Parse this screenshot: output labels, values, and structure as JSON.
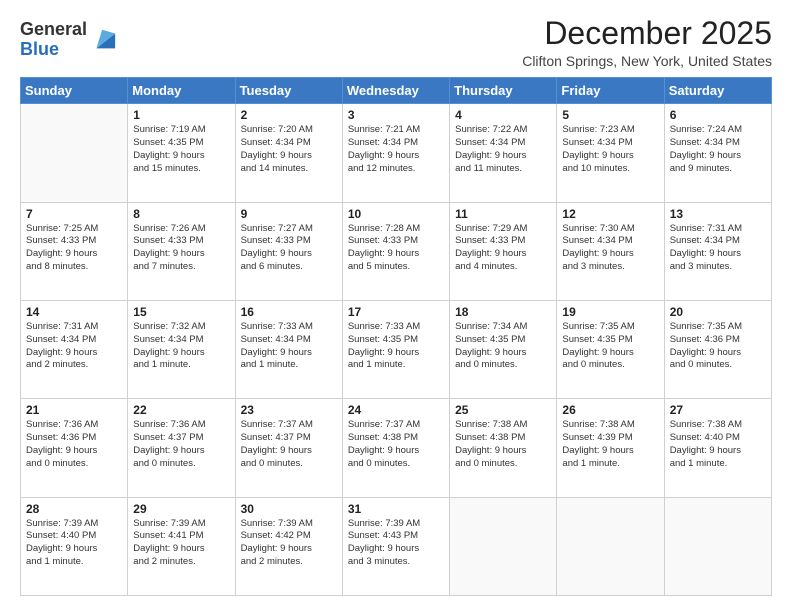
{
  "header": {
    "logo_general": "General",
    "logo_blue": "Blue",
    "month_title": "December 2025",
    "location": "Clifton Springs, New York, United States"
  },
  "days_of_week": [
    "Sunday",
    "Monday",
    "Tuesday",
    "Wednesday",
    "Thursday",
    "Friday",
    "Saturday"
  ],
  "weeks": [
    [
      {
        "day": "",
        "content": ""
      },
      {
        "day": "1",
        "content": "Sunrise: 7:19 AM\nSunset: 4:35 PM\nDaylight: 9 hours\nand 15 minutes."
      },
      {
        "day": "2",
        "content": "Sunrise: 7:20 AM\nSunset: 4:34 PM\nDaylight: 9 hours\nand 14 minutes."
      },
      {
        "day": "3",
        "content": "Sunrise: 7:21 AM\nSunset: 4:34 PM\nDaylight: 9 hours\nand 12 minutes."
      },
      {
        "day": "4",
        "content": "Sunrise: 7:22 AM\nSunset: 4:34 PM\nDaylight: 9 hours\nand 11 minutes."
      },
      {
        "day": "5",
        "content": "Sunrise: 7:23 AM\nSunset: 4:34 PM\nDaylight: 9 hours\nand 10 minutes."
      },
      {
        "day": "6",
        "content": "Sunrise: 7:24 AM\nSunset: 4:34 PM\nDaylight: 9 hours\nand 9 minutes."
      }
    ],
    [
      {
        "day": "7",
        "content": "Sunrise: 7:25 AM\nSunset: 4:33 PM\nDaylight: 9 hours\nand 8 minutes."
      },
      {
        "day": "8",
        "content": "Sunrise: 7:26 AM\nSunset: 4:33 PM\nDaylight: 9 hours\nand 7 minutes."
      },
      {
        "day": "9",
        "content": "Sunrise: 7:27 AM\nSunset: 4:33 PM\nDaylight: 9 hours\nand 6 minutes."
      },
      {
        "day": "10",
        "content": "Sunrise: 7:28 AM\nSunset: 4:33 PM\nDaylight: 9 hours\nand 5 minutes."
      },
      {
        "day": "11",
        "content": "Sunrise: 7:29 AM\nSunset: 4:33 PM\nDaylight: 9 hours\nand 4 minutes."
      },
      {
        "day": "12",
        "content": "Sunrise: 7:30 AM\nSunset: 4:34 PM\nDaylight: 9 hours\nand 3 minutes."
      },
      {
        "day": "13",
        "content": "Sunrise: 7:31 AM\nSunset: 4:34 PM\nDaylight: 9 hours\nand 3 minutes."
      }
    ],
    [
      {
        "day": "14",
        "content": "Sunrise: 7:31 AM\nSunset: 4:34 PM\nDaylight: 9 hours\nand 2 minutes."
      },
      {
        "day": "15",
        "content": "Sunrise: 7:32 AM\nSunset: 4:34 PM\nDaylight: 9 hours\nand 1 minute."
      },
      {
        "day": "16",
        "content": "Sunrise: 7:33 AM\nSunset: 4:34 PM\nDaylight: 9 hours\nand 1 minute."
      },
      {
        "day": "17",
        "content": "Sunrise: 7:33 AM\nSunset: 4:35 PM\nDaylight: 9 hours\nand 1 minute."
      },
      {
        "day": "18",
        "content": "Sunrise: 7:34 AM\nSunset: 4:35 PM\nDaylight: 9 hours\nand 0 minutes."
      },
      {
        "day": "19",
        "content": "Sunrise: 7:35 AM\nSunset: 4:35 PM\nDaylight: 9 hours\nand 0 minutes."
      },
      {
        "day": "20",
        "content": "Sunrise: 7:35 AM\nSunset: 4:36 PM\nDaylight: 9 hours\nand 0 minutes."
      }
    ],
    [
      {
        "day": "21",
        "content": "Sunrise: 7:36 AM\nSunset: 4:36 PM\nDaylight: 9 hours\nand 0 minutes."
      },
      {
        "day": "22",
        "content": "Sunrise: 7:36 AM\nSunset: 4:37 PM\nDaylight: 9 hours\nand 0 minutes."
      },
      {
        "day": "23",
        "content": "Sunrise: 7:37 AM\nSunset: 4:37 PM\nDaylight: 9 hours\nand 0 minutes."
      },
      {
        "day": "24",
        "content": "Sunrise: 7:37 AM\nSunset: 4:38 PM\nDaylight: 9 hours\nand 0 minutes."
      },
      {
        "day": "25",
        "content": "Sunrise: 7:38 AM\nSunset: 4:38 PM\nDaylight: 9 hours\nand 0 minutes."
      },
      {
        "day": "26",
        "content": "Sunrise: 7:38 AM\nSunset: 4:39 PM\nDaylight: 9 hours\nand 1 minute."
      },
      {
        "day": "27",
        "content": "Sunrise: 7:38 AM\nSunset: 4:40 PM\nDaylight: 9 hours\nand 1 minute."
      }
    ],
    [
      {
        "day": "28",
        "content": "Sunrise: 7:39 AM\nSunset: 4:40 PM\nDaylight: 9 hours\nand 1 minute."
      },
      {
        "day": "29",
        "content": "Sunrise: 7:39 AM\nSunset: 4:41 PM\nDaylight: 9 hours\nand 2 minutes."
      },
      {
        "day": "30",
        "content": "Sunrise: 7:39 AM\nSunset: 4:42 PM\nDaylight: 9 hours\nand 2 minutes."
      },
      {
        "day": "31",
        "content": "Sunrise: 7:39 AM\nSunset: 4:43 PM\nDaylight: 9 hours\nand 3 minutes."
      },
      {
        "day": "",
        "content": ""
      },
      {
        "day": "",
        "content": ""
      },
      {
        "day": "",
        "content": ""
      }
    ]
  ]
}
